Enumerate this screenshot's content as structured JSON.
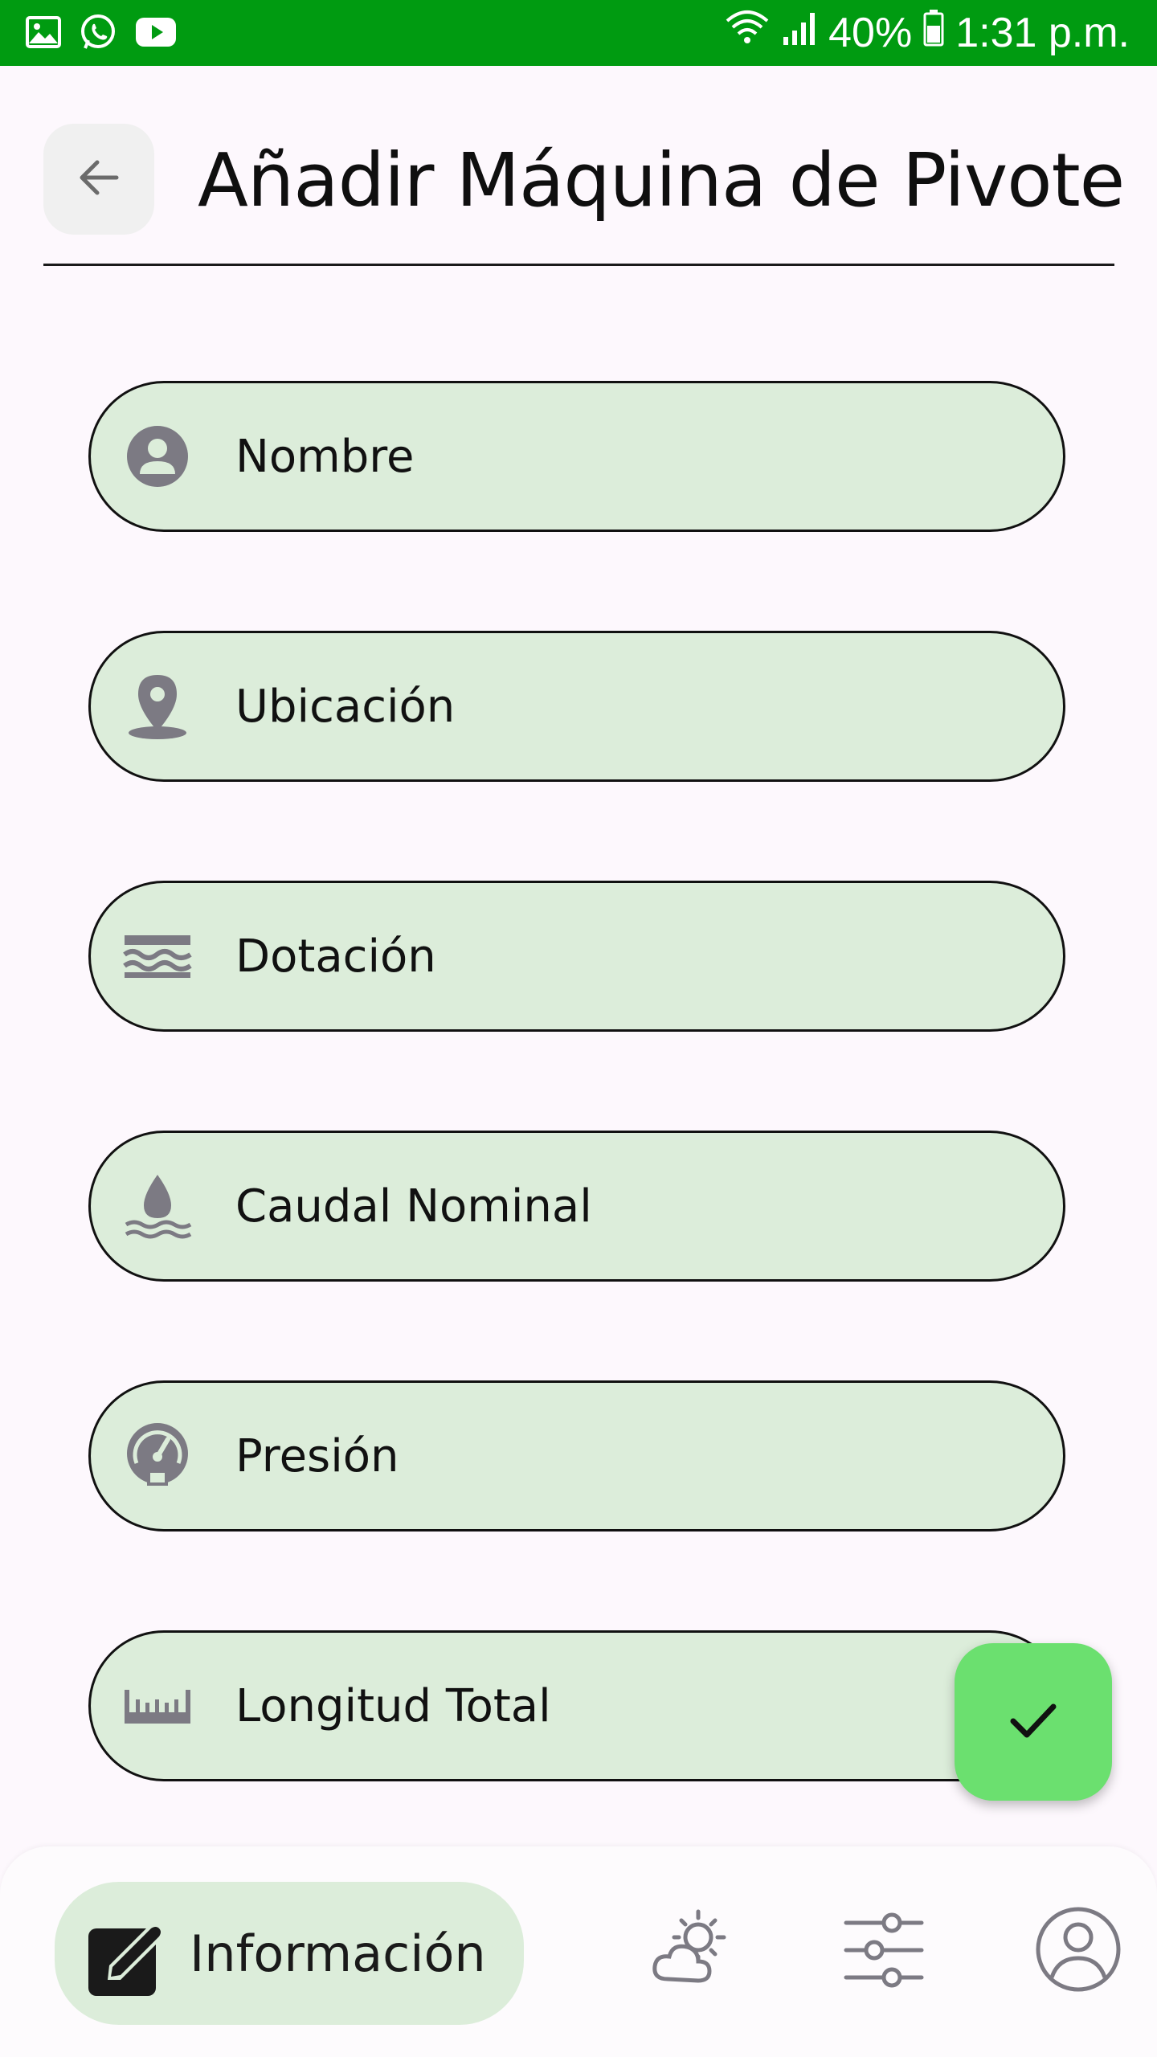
{
  "status_bar": {
    "battery": "40%",
    "time": "1:31 p.m.",
    "left_icons": [
      "gallery-icon",
      "whatsapp-icon",
      "youtube-icon"
    ],
    "right_icons": [
      "wifi-icon",
      "signal-icon",
      "battery-icon"
    ]
  },
  "header": {
    "title": "Añadir Máquina de Pivote",
    "back_icon": "arrow-left-icon"
  },
  "form": {
    "fields": [
      {
        "label": "Nombre",
        "icon": "person-icon"
      },
      {
        "label": "Ubicación",
        "icon": "location-pin-icon"
      },
      {
        "label": "Dotación",
        "icon": "waves-icon"
      },
      {
        "label": "Caudal Nominal",
        "icon": "water-drop-icon"
      },
      {
        "label": "Presión",
        "icon": "gauge-icon"
      },
      {
        "label": "Longitud Total",
        "icon": "ruler-icon"
      }
    ]
  },
  "fab": {
    "icon": "check-icon"
  },
  "bottom_nav": {
    "items": [
      {
        "label": "Información",
        "icon": "edit-note-icon",
        "active": true
      },
      {
        "label": "",
        "icon": "weather-icon",
        "active": false
      },
      {
        "label": "",
        "icon": "sliders-icon",
        "active": false
      },
      {
        "label": "",
        "icon": "account-icon",
        "active": false
      }
    ]
  },
  "colors": {
    "status_bar": "#009b11",
    "field_bg": "#dcedda",
    "fab_bg": "#6be06f",
    "icon_gray": "#7c7a83"
  }
}
